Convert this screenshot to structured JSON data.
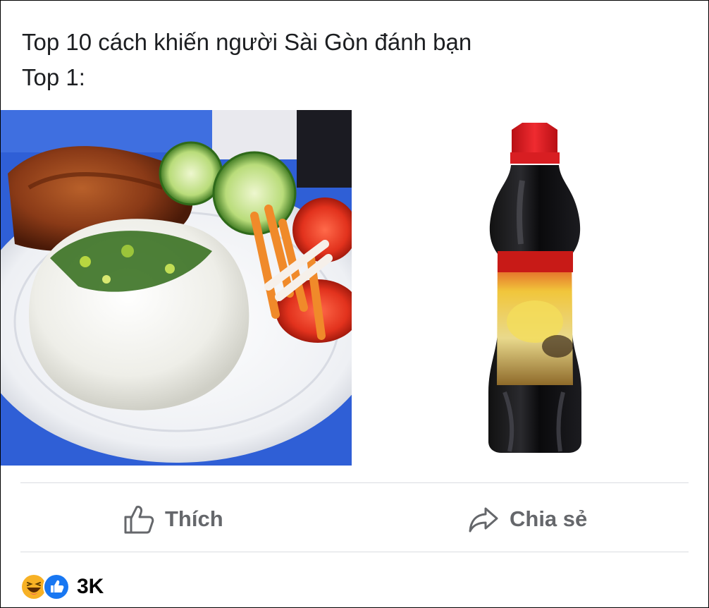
{
  "post": {
    "text_line1": "Top 10 cách khiến người Sài Gòn đánh bạn",
    "text_line2": "Top 1:"
  },
  "photos": [
    {
      "subject": "plate of broken rice with grilled pork chop, scallion oil, cucumber, tomato and pickled carrot"
    },
    {
      "subject": "bottle of soy sauce with red cap and blurred label"
    }
  ],
  "actions": {
    "like_label": "Thích",
    "like_icon": "thumbs-up-icon",
    "share_label": "Chia sẻ",
    "share_icon": "share-arrow-icon"
  },
  "reactions": {
    "icons": [
      "haha-reaction-icon",
      "like-reaction-icon"
    ],
    "count": "3K"
  },
  "colors": {
    "action_text": "#65676b",
    "divider": "#dadde1",
    "like_blue": "#1877f2",
    "haha_yellow": "#f7b125"
  }
}
